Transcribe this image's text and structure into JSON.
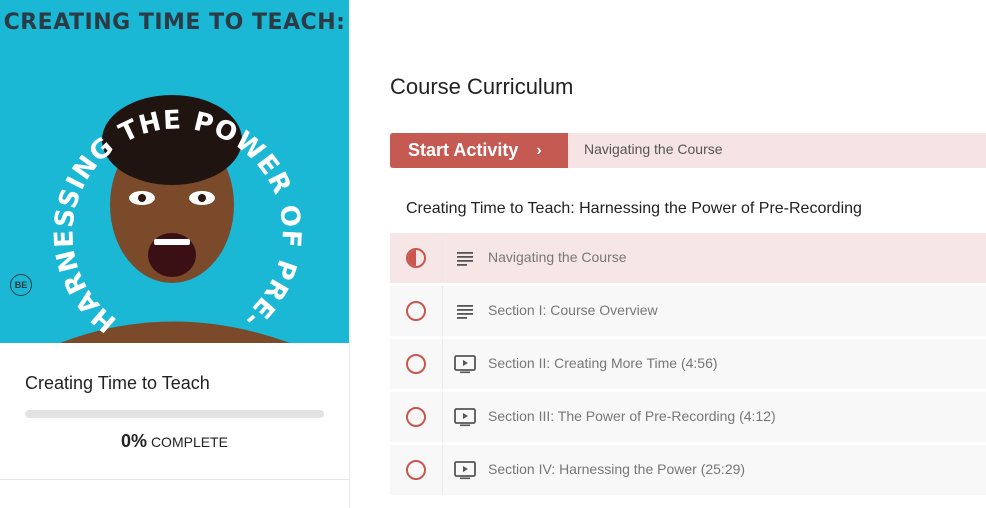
{
  "cover": {
    "title": "CREATING TIME TO TEACH:",
    "arc_text": "HARNESSING THE POWER OF PRE-RECORDING",
    "badge": "BE"
  },
  "course": {
    "name": "Creating Time to Teach",
    "progress_fraction": 0,
    "progress_pct": "0%",
    "progress_suffix": "COMPLETE"
  },
  "main": {
    "heading": "Course Curriculum",
    "start_label": "Start Activity",
    "start_chevron": "›",
    "next_activity": "Navigating the Course",
    "section_title": "Creating Time to Teach: Harnessing the Power of Pre-Recording",
    "lessons": [
      {
        "label": "Navigating the Course",
        "type": "text",
        "status": "in-progress"
      },
      {
        "label": "Section I: Course Overview",
        "type": "text",
        "status": "not-started"
      },
      {
        "label": "Section II: Creating More Time (4:56)",
        "type": "video",
        "status": "not-started"
      },
      {
        "label": "Section III: The Power of Pre-Recording (4:12)",
        "type": "video",
        "status": "not-started"
      },
      {
        "label": "Section IV: Harnessing the Power (25:29)",
        "type": "video",
        "status": "not-started"
      }
    ]
  },
  "colors": {
    "accent": "#c55a52",
    "cover_bg": "#1ab8d4"
  },
  "icons": {
    "text_lesson": "text-lines-icon",
    "video_lesson": "video-play-icon",
    "status": "status-circle-icon"
  }
}
